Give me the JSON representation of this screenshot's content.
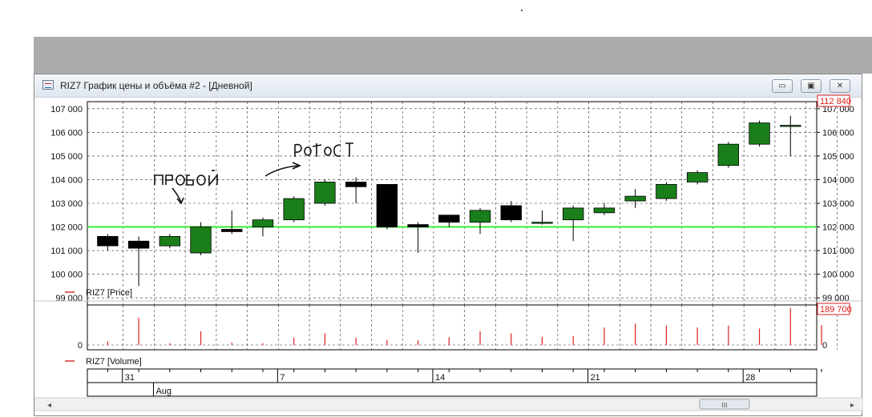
{
  "window": {
    "title": "RIZ7 График цены и объёма #2 - [Дневной]",
    "minimize_icon": "minimize-icon",
    "maximize_icon": "maximize-icon",
    "close_icon": "close-icon"
  },
  "colors": {
    "up": "#1a7f1a",
    "down": "#000000",
    "support_line": "#33ee33",
    "volume": "#e02020",
    "price_label": "#e02020"
  },
  "chart_data": [
    {
      "type": "candlestick",
      "series_name": "RIZ7 [Price]",
      "ylim": [
        98700,
        107300
      ],
      "yticks": [
        "107 000",
        "106 000",
        "105 000",
        "104 000",
        "103 000",
        "102 000",
        "101 000",
        "100 000",
        "99 000"
      ],
      "last_price_label": "112 840",
      "support_level": 102000,
      "candles": [
        {
          "o": 101600,
          "c": 101200,
          "h": 101700,
          "l": 101000
        },
        {
          "o": 101400,
          "c": 101100,
          "h": 101600,
          "l": 99500
        },
        {
          "o": 101200,
          "c": 101600,
          "h": 101700,
          "l": 101100
        },
        {
          "o": 100900,
          "c": 102000,
          "h": 102200,
          "l": 100800
        },
        {
          "o": 101900,
          "c": 101800,
          "h": 102700,
          "l": 101700
        },
        {
          "o": 102000,
          "c": 102300,
          "h": 102400,
          "l": 101600
        },
        {
          "o": 102300,
          "c": 103200,
          "h": 103300,
          "l": 102200
        },
        {
          "o": 103000,
          "c": 103900,
          "h": 104000,
          "l": 102900
        },
        {
          "o": 103900,
          "c": 103700,
          "h": 104100,
          "l": 103000
        },
        {
          "o": 103800,
          "c": 102000,
          "h": 103800,
          "l": 101900
        },
        {
          "o": 102100,
          "c": 102000,
          "h": 102200,
          "l": 100900
        },
        {
          "o": 102500,
          "c": 102200,
          "h": 102500,
          "l": 102000
        },
        {
          "o": 102200,
          "c": 102700,
          "h": 102800,
          "l": 101700
        },
        {
          "o": 102900,
          "c": 102300,
          "h": 103100,
          "l": 102200
        },
        {
          "o": 102200,
          "c": 102200,
          "h": 102700,
          "l": 102100
        },
        {
          "o": 102300,
          "c": 102800,
          "h": 102900,
          "l": 101400
        },
        {
          "o": 102600,
          "c": 102800,
          "h": 103000,
          "l": 102500
        },
        {
          "o": 103100,
          "c": 103300,
          "h": 103600,
          "l": 102800
        },
        {
          "o": 103200,
          "c": 103800,
          "h": 103900,
          "l": 103100
        },
        {
          "o": 103900,
          "c": 104300,
          "h": 104400,
          "l": 103800
        },
        {
          "o": 104600,
          "c": 105500,
          "h": 105600,
          "l": 104500
        },
        {
          "o": 105500,
          "c": 106400,
          "h": 106500,
          "l": 105400
        },
        {
          "o": 106300,
          "c": 106300,
          "h": 106700,
          "l": 105000
        }
      ],
      "annotations": [
        "пробой",
        "ретест"
      ]
    },
    {
      "type": "bar",
      "series_name": "RIZ7 [Volume]",
      "ylim": [
        0,
        189700
      ],
      "yticks": [
        "0"
      ],
      "last_value_label": "189 700",
      "values": [
        18000,
        140000,
        9000,
        70000,
        12000,
        9000,
        38000,
        60000,
        38000,
        26000,
        24000,
        40000,
        70000,
        60000,
        42000,
        45000,
        90000,
        110000,
        100000,
        90000,
        100000,
        85000,
        189700,
        102000
      ]
    }
  ],
  "time_axis": {
    "day_labels": [
      "31",
      "7",
      "14",
      "21",
      "28"
    ],
    "month_labels": [
      "Aug"
    ]
  },
  "scrollbar": {
    "thumb_label": "III",
    "left_arrow": "◂",
    "right_arrow": "▸"
  }
}
